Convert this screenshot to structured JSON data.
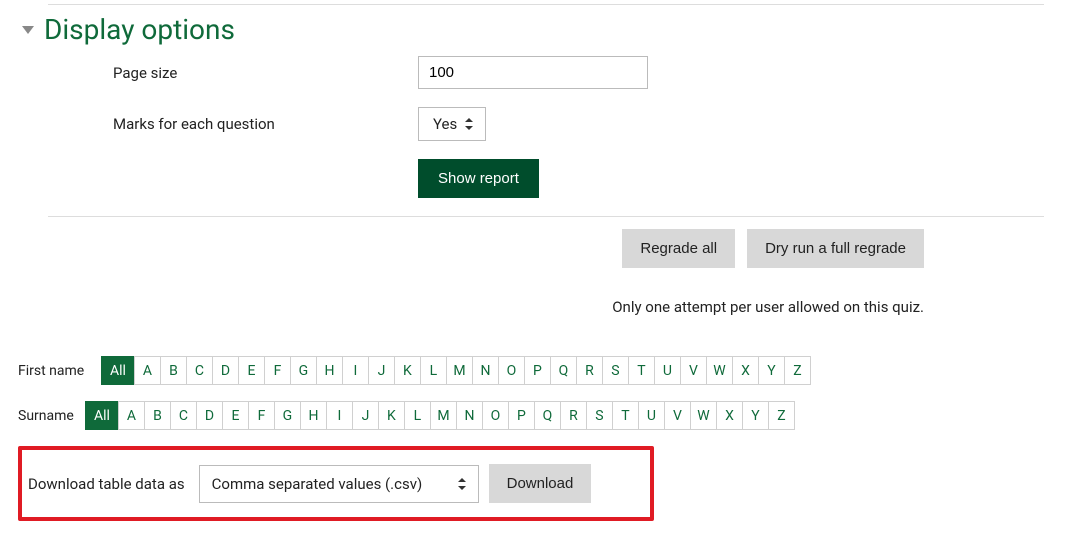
{
  "section": {
    "title": "Display options",
    "fields": {
      "page_size": {
        "label": "Page size",
        "value": "100"
      },
      "marks_each_q": {
        "label": "Marks for each question",
        "value": "Yes"
      }
    },
    "submit_label": "Show report"
  },
  "actions": {
    "regrade_all": "Regrade all",
    "dry_run": "Dry run a full regrade"
  },
  "info_text": "Only one attempt per user allowed on this quiz.",
  "filters": {
    "first_name": {
      "label": "First name",
      "all_label": "All",
      "selected": "All"
    },
    "surname": {
      "label": "Surname",
      "all_label": "All",
      "selected": "All"
    },
    "letters": [
      "A",
      "B",
      "C",
      "D",
      "E",
      "F",
      "G",
      "H",
      "I",
      "J",
      "K",
      "L",
      "M",
      "N",
      "O",
      "P",
      "Q",
      "R",
      "S",
      "T",
      "U",
      "V",
      "W",
      "X",
      "Y",
      "Z"
    ]
  },
  "download": {
    "label": "Download table data as",
    "format": "Comma separated values (.csv)",
    "button": "Download"
  }
}
